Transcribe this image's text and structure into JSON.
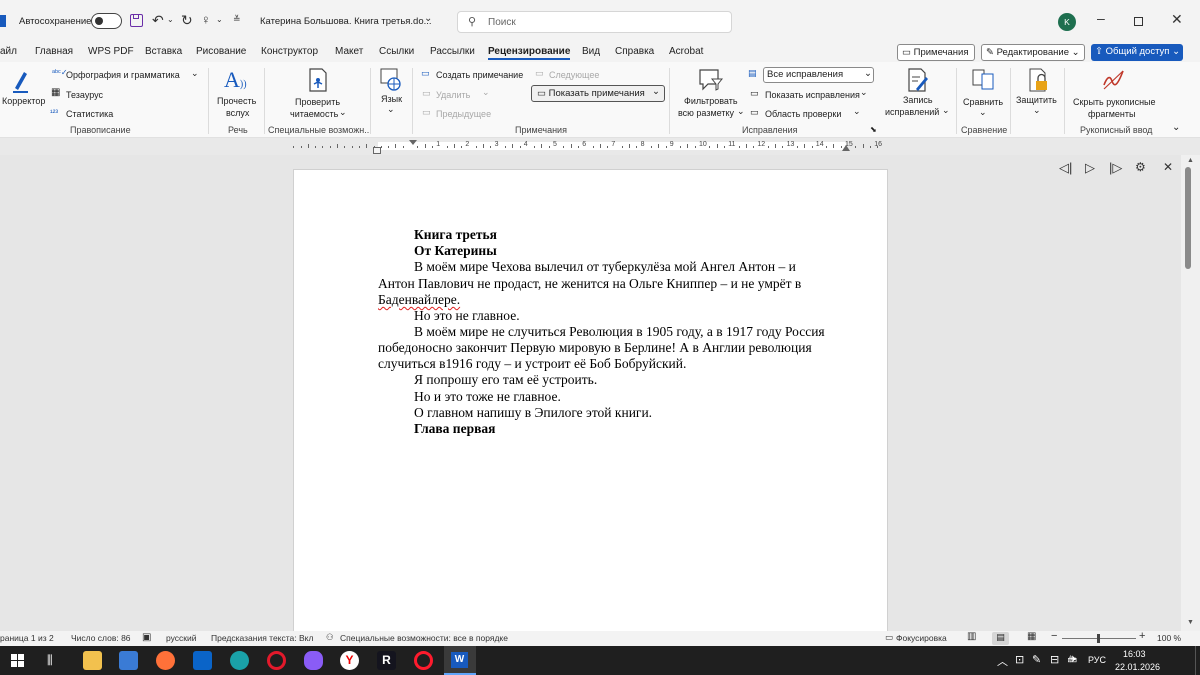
{
  "titlebar": {
    "autosave_label": "Автосохранение",
    "doc_title": "Катерина Большова. Книга третья.do...",
    "search_placeholder": "Поиск",
    "avatar_letter": "K"
  },
  "menu": {
    "tabs": [
      "айл",
      "Главная",
      "WPS PDF",
      "Вставка",
      "Рисование",
      "Конструктор",
      "Макет",
      "Ссылки",
      "Рассылки",
      "Рецензирование",
      "Вид",
      "Справка",
      "Acrobat"
    ],
    "comments_btn": "Примечания",
    "editing_btn": "Редактирование",
    "share_btn": "Общий доступ"
  },
  "ribbon": {
    "corrector": "Корректор",
    "spelling": "Орфография и грамматика",
    "thesaurus": "Тезаурус",
    "statistics": "Статистика",
    "group_spelling": "Правописание",
    "read_aloud_1": "Прочесть",
    "read_aloud_2": "вслух",
    "group_speech": "Речь",
    "check_1": "Проверить",
    "check_2": "читаемость",
    "group_access": "Специальные возможн...",
    "language": "Язык",
    "new_comment": "Создать примечание",
    "delete": "Удалить",
    "previous": "Предыдущее",
    "next": "Следующее",
    "show_comments": "Показать примечания",
    "group_comments": "Примечания",
    "filter_1": "Фильтровать",
    "filter_2": "всю разметку",
    "all_changes": "Все исправления",
    "show_changes": "Показать исправления",
    "review_pane": "Область проверки",
    "record_1": "Запись",
    "record_2": "исправлений",
    "group_tracking": "Исправления",
    "compare": "Сравнить",
    "group_compare": "Сравнение",
    "protect": "Защитить",
    "hide_ink_1": "Скрыть рукописные",
    "hide_ink_2": "фрагменты",
    "group_ink": "Рукописный ввод"
  },
  "ruler": {
    "numbers": [
      "1",
      "2",
      "3",
      "4",
      "5",
      "6",
      "7",
      "8",
      "9",
      "10",
      "11",
      "12",
      "13",
      "14",
      "15",
      "16"
    ]
  },
  "document": {
    "line1": "Книга третья",
    "line2": "От Катерины",
    "p1a": "В моём мире Чехова вылечил от туберкулёза мой Ангел Антон – и",
    "p1b": "Антон Павлович не продаст, не женится на Ольге Книппер – и не умрёт в",
    "p1c": "Баденвайлере.",
    "p2": "Но это не главное.",
    "p3a": "В моём мире не случиться Революция в 1905 году, а в 1917 году Россия",
    "p3b": "победоносно закончит Первую мировую в Берлине! А в Англии революция",
    "p3c": "случиться в1916 году – и устроит её Боб Бобруйский.",
    "p4": "Я попрошу его там её устроить.",
    "p5": "Но и это тоже не главное.",
    "p6": "О главном напишу в Эпилоге этой книги.",
    "p7": "Глава первая"
  },
  "statusbar": {
    "page": "раница 1 из 2",
    "words": "Число слов: 86",
    "lang": "русский",
    "predict": "Предсказания текста: Вкл",
    "access": "Специальные возможности: все в порядке",
    "focus": "Фокусировка",
    "zoom": "100 %"
  },
  "taskbar": {
    "lang": "РУС",
    "time": "16:03",
    "date": "22.01.2026"
  },
  "colors": {
    "accent": "#185abd",
    "word_blue": "#185abd",
    "taskbar": "#1f1f1f"
  }
}
